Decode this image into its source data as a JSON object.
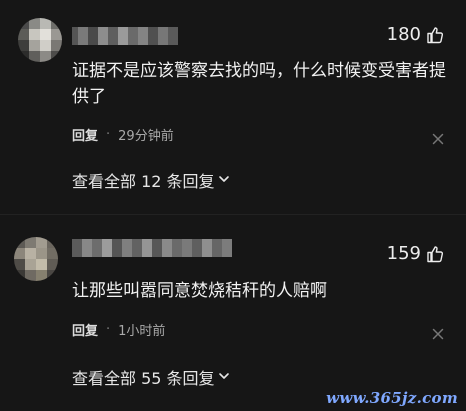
{
  "comments": [
    {
      "likes": "180",
      "text": "证据不是应该警察去找的吗，什么时候变受害者提供了",
      "reply_label": "回复",
      "separator": "·",
      "time": "29分钟前",
      "more_replies": "查看全部 12 条回复"
    },
    {
      "likes": "159",
      "text": "让那些叫嚣同意焚烧秸秆的人赔啊",
      "reply_label": "回复",
      "separator": "·",
      "time": "1小时前",
      "more_replies": "查看全部 55 条回复"
    }
  ],
  "icons": {
    "like": "thumbs-up-icon",
    "close": "close-icon",
    "expand": "chevron-down-icon"
  },
  "watermark": "www.365jz.com"
}
